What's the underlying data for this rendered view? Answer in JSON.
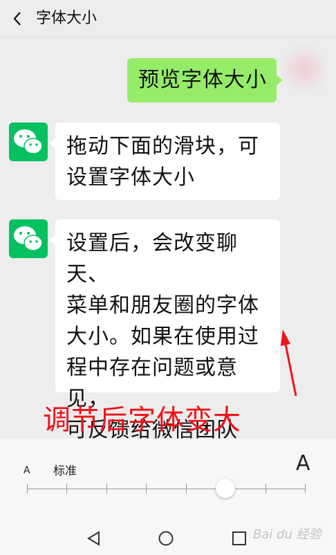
{
  "header": {
    "title": "字体大小"
  },
  "messages": {
    "preview": "预览字体大小",
    "drag_hint": "拖动下面的滑块，可\n设置字体大小",
    "info": "设置后，会改变聊天、\n菜单和朋友圈的字体\n大小。如果在使用过\n程中存在问题或意见，\n可反馈给微信团队"
  },
  "annotation": {
    "text": "调节后字体变大"
  },
  "slider": {
    "small_label": "A",
    "standard_label": "标准",
    "large_label": "A",
    "level": 6,
    "levels": 8
  },
  "watermark": "Bai du 经验",
  "colors": {
    "accent": "#07c160",
    "bubble_me": "#95ec69",
    "annotation": "#f0121a"
  }
}
